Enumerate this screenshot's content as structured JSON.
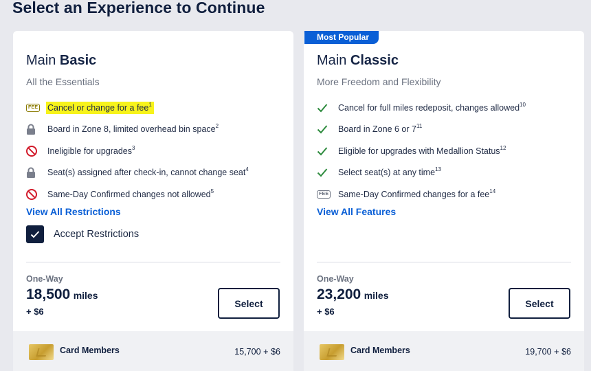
{
  "page": {
    "heading": "Select an Experience to Continue"
  },
  "badge": "Most Popular",
  "basic": {
    "title_prefix": "Main",
    "title_bold": "Basic",
    "subtitle": "All the Essentials",
    "features": [
      {
        "icon": "fee-icon",
        "icon_text": "FEE",
        "text": "Cancel or change for a fee",
        "sup": "1",
        "highlighted": true
      },
      {
        "icon": "lock-icon",
        "text": "Board in Zone 8, limited overhead bin space",
        "sup": "2"
      },
      {
        "icon": "no-entry-icon",
        "text": "Ineligible for upgrades",
        "sup": "3"
      },
      {
        "icon": "lock-icon",
        "text": "Seat(s) assigned after check-in, cannot change seat",
        "sup": "4"
      },
      {
        "icon": "no-entry-icon",
        "text": "Same-Day Confirmed changes not allowed",
        "sup": "5"
      }
    ],
    "link": "View All Restrictions",
    "accept_label": "Accept Restrictions",
    "accept_checked": true,
    "trip_type": "One-Way",
    "miles": "18,500",
    "miles_unit": "miles",
    "tax": "+ $6",
    "select_label": "Select",
    "card_members_label": "Card Members",
    "card_members_price": "15,700",
    "card_members_plus": "+",
    "card_members_tax": "$6"
  },
  "classic": {
    "title_prefix": "Main",
    "title_bold": "Classic",
    "subtitle": "More Freedom and Flexibility",
    "features": [
      {
        "icon": "check-icon",
        "text": "Cancel for full miles redeposit, changes allowed",
        "sup": "10"
      },
      {
        "icon": "check-icon",
        "text": "Board in Zone 6 or 7",
        "sup": "11"
      },
      {
        "icon": "check-icon",
        "text": "Eligible for upgrades with Medallion Status",
        "sup": "12"
      },
      {
        "icon": "check-icon",
        "text": "Select seat(s) at any time",
        "sup": "13"
      },
      {
        "icon": "fee-icon",
        "icon_text": "FEE",
        "text": "Same-Day Confirmed changes for a fee",
        "sup": "14"
      }
    ],
    "link": "View All Features",
    "trip_type": "One-Way",
    "miles": "23,200",
    "miles_unit": "miles",
    "tax": "+ $6",
    "select_label": "Select",
    "card_members_label": "Card Members",
    "card_members_price": "19,700",
    "card_members_plus": "+",
    "card_members_tax": "$6"
  },
  "colors": {
    "accent": "#0a5fd6",
    "navy": "#101f3e",
    "highlight": "#f7f31b",
    "check": "#2e8b3e",
    "no_entry": "#d21a2a"
  }
}
